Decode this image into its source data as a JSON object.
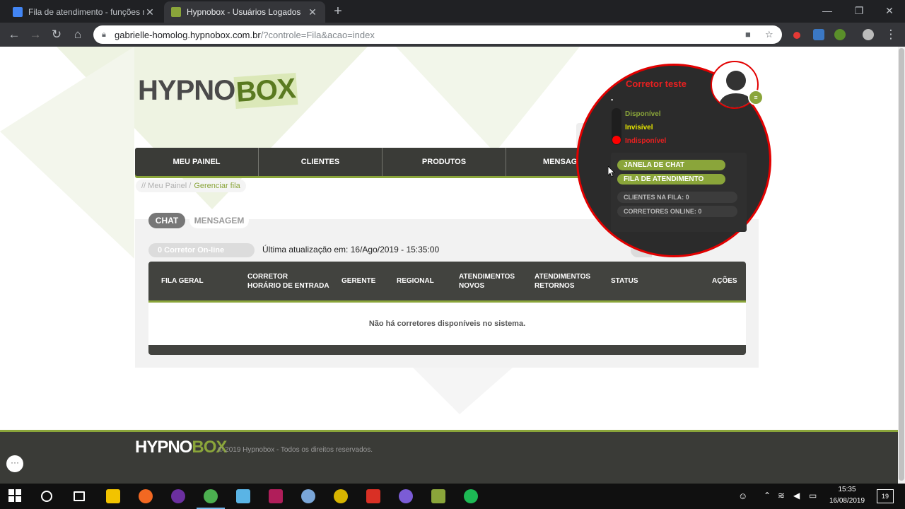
{
  "browser": {
    "tabs": [
      {
        "title": "Fila de atendimento - funções m",
        "active": false
      },
      {
        "title": "Hypnobox - Usuários Logados",
        "active": true
      }
    ],
    "new_tab_label": "+",
    "url_host": "gabrielle-homolog.hypnobox.com.br",
    "url_path": "/?controle=Fila&acao=index"
  },
  "site": {
    "logo_left": "HYPNO",
    "logo_right": "BOX",
    "nav": [
      "MEU PAINEL",
      "CLIENTES",
      "PRODUTOS",
      "MENSAGENS"
    ],
    "breadcrumb_prefix": "// Meu Painel /",
    "breadcrumb_current": "Gerenciar fila",
    "tabs": {
      "chat": "CHAT",
      "mensagem": "MENSAGEM"
    },
    "online_count": "0 Corretor On-line",
    "last_update": "Última atualização em: 16/Ago/2019 - 15:35:00",
    "table": {
      "headers": [
        {
          "line1": "FILA GERAL",
          "line2": ""
        },
        {
          "line1": "CORRETOR",
          "line2": "HORÁRIO DE ENTRADA"
        },
        {
          "line1": "GERENTE",
          "line2": ""
        },
        {
          "line1": "REGIONAL",
          "line2": ""
        },
        {
          "line1": "ATENDIMENTOS",
          "line2": "NOVOS"
        },
        {
          "line1": "ATENDIMENTOS",
          "line2": "RETORNOS"
        },
        {
          "line1": "STATUS",
          "line2": ""
        },
        {
          "line1": "AÇÕES",
          "line2": ""
        }
      ],
      "empty_message": "Não há corretores disponíveis no sistema."
    },
    "footer_copy": "© 2019 Hypnobox - Todos os direitos reservados."
  },
  "profile_popup": {
    "name": "Corretor teste",
    "statuses": [
      {
        "label": "Disponível",
        "color": "#8aa53a"
      },
      {
        "label": "Invisível",
        "color": "#e6e600"
      },
      {
        "label": "Indisponível",
        "color": "#e82020"
      }
    ],
    "current_status": "Indisponível",
    "buttons": [
      "JANELA DE CHAT",
      "FILA DE ATENDIMENTO"
    ],
    "info": [
      "CLIENTES NA FILA: 0",
      "CORRETORES ONLINE: 0"
    ]
  },
  "taskbar": {
    "time": "15:35",
    "date": "16/08/2019",
    "notification_count": "19"
  },
  "colors": {
    "brand_green": "#8aa53a",
    "nav_dark": "#3a3b37",
    "alert_red": "#e20000"
  }
}
